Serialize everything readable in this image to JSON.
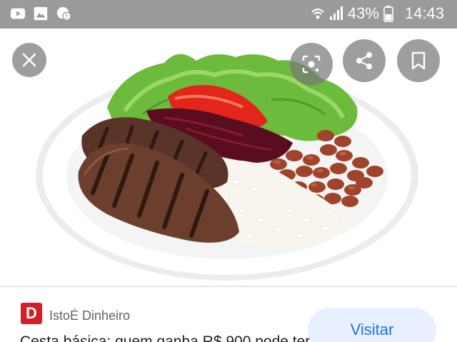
{
  "status_bar": {
    "left_icons": [
      "youtube-icon",
      "image-icon",
      "chat-alert-icon"
    ],
    "battery_text": "43%",
    "time": "14:43"
  },
  "viewer": {
    "image_subject": "plate-of-food-image",
    "buttons": [
      "close-icon",
      "lens-icon",
      "share-icon",
      "bookmark-icon"
    ]
  },
  "source": {
    "logo_letter": "D",
    "name": "IstoÉ Dinheiro",
    "title": "Cesta básica: quem ganha R$ 900 pode ter",
    "visit_label": "Visitar"
  },
  "colors": {
    "status_bar": "#9a9a9a",
    "logo": "#d32027",
    "visit_bg": "#e8f0fe",
    "visit_text": "#1a73e8"
  }
}
